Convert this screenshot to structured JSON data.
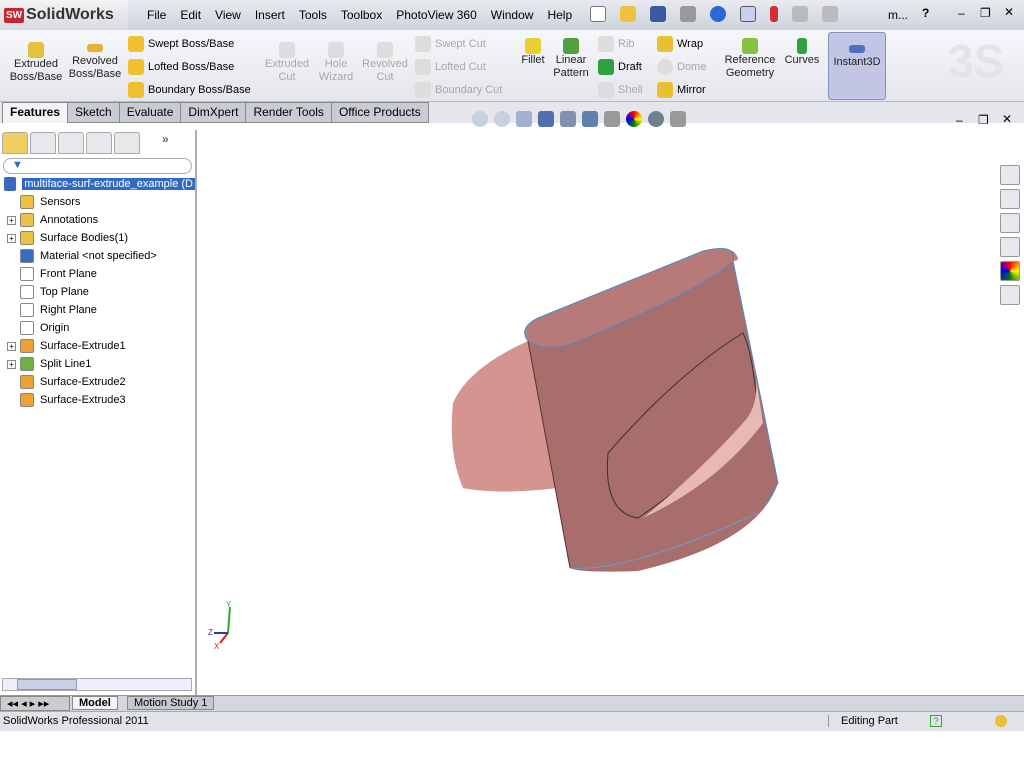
{
  "app": {
    "logo": "SolidWorks",
    "logo_badge": "SW"
  },
  "menu": [
    "File",
    "Edit",
    "View",
    "Insert",
    "Tools",
    "Toolbox",
    "PhotoView 360",
    "Window",
    "Help"
  ],
  "menu_extra": "m...",
  "ribbon": {
    "extruded_boss": "Extruded Boss/Base",
    "revolved_boss": "Revolved Boss/Base",
    "swept_boss": "Swept Boss/Base",
    "lofted_boss": "Lofted Boss/Base",
    "boundary_boss": "Boundary Boss/Base",
    "extruded_cut": "Extruded Cut",
    "hole_wizard": "Hole Wizard",
    "revolved_cut": "Revolved Cut",
    "swept_cut": "Swept Cut",
    "lofted_cut": "Lofted Cut",
    "boundary_cut": "Boundary Cut",
    "fillet": "Fillet",
    "linear_pattern": "Linear Pattern",
    "rib": "Rib",
    "draft": "Draft",
    "shell": "Shell",
    "wrap": "Wrap",
    "dome": "Dome",
    "mirror": "Mirror",
    "reference_geometry": "Reference Geometry",
    "curves": "Curves",
    "instant3d": "Instant3D"
  },
  "tabs": [
    "Features",
    "Sketch",
    "Evaluate",
    "DimXpert",
    "Render Tools",
    "Office Products"
  ],
  "tree": {
    "root": "multiface-surf-extrude_example  (D",
    "items": [
      {
        "label": "Sensors",
        "expand": false,
        "color": "#f0c040"
      },
      {
        "label": "Annotations",
        "expand": true,
        "color": "#f0c040"
      },
      {
        "label": "Surface Bodies(1)",
        "expand": true,
        "color": "#f0c040"
      },
      {
        "label": "Material <not specified>",
        "expand": false,
        "color": "#3a6ac0"
      },
      {
        "label": "Front Plane",
        "expand": false,
        "color": "#ffffff"
      },
      {
        "label": "Top Plane",
        "expand": false,
        "color": "#ffffff"
      },
      {
        "label": "Right Plane",
        "expand": false,
        "color": "#ffffff"
      },
      {
        "label": "Origin",
        "expand": false,
        "color": "#ffffff"
      },
      {
        "label": "Surface-Extrude1",
        "expand": true,
        "color": "#f0a030"
      },
      {
        "label": "Split Line1",
        "expand": true,
        "color": "#70b040"
      },
      {
        "label": "Surface-Extrude2",
        "expand": false,
        "color": "#f0a030"
      },
      {
        "label": "Surface-Extrude3",
        "expand": false,
        "color": "#f0a030"
      }
    ]
  },
  "bottom_tabs": [
    "Model",
    "Motion Study 1"
  ],
  "status": {
    "product": "SolidWorks Professional 2011",
    "mode": "Editing Part"
  },
  "colors": {
    "part": "#c98a88",
    "accent": "#316ac5"
  }
}
